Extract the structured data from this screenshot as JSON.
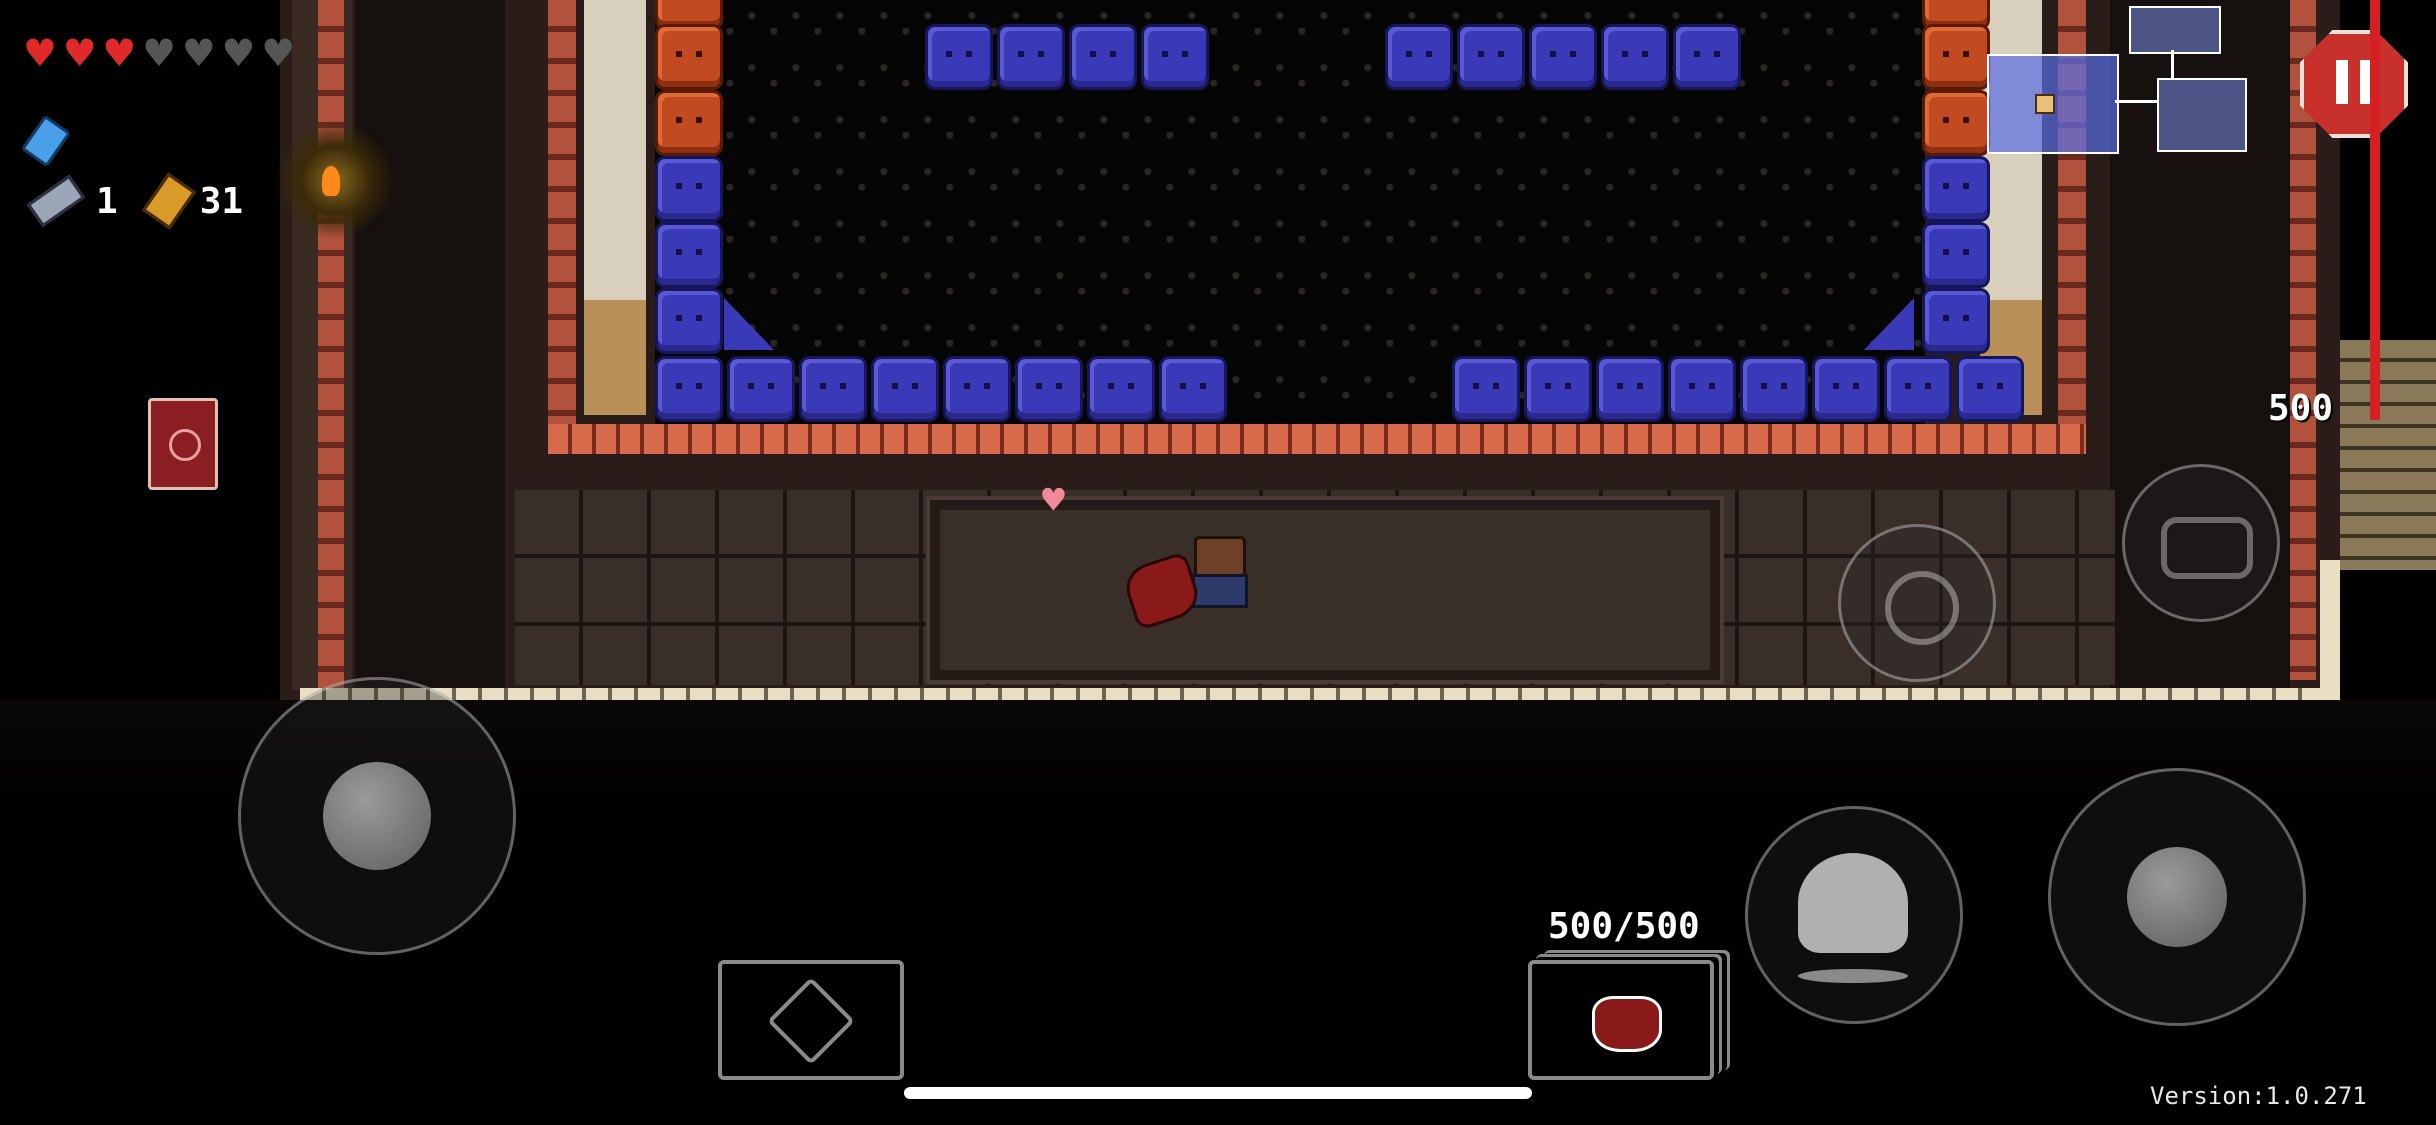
{
  "hud": {
    "hearts": {
      "full": 3,
      "empty": 4
    },
    "blanks_count": "1",
    "keys_icon": "key-icon",
    "ammo_count": "31",
    "shells_icon": "shell-casing-icon"
  },
  "boss": {
    "hp_label": "500"
  },
  "weapon": {
    "ammo": "500/500"
  },
  "footer": {
    "version": "Version:1.0.271"
  },
  "icons": {
    "pause": "pause-icon",
    "dodge": "dodge-roll-icon",
    "reload": "reload-icon",
    "interact": "interact-icon",
    "item": "active-item-icon",
    "gun": "demon-head-gun-icon"
  },
  "colors": {
    "heart": "#e02a2a",
    "boss_bar": "#d42020",
    "pause": "#c8302c"
  }
}
